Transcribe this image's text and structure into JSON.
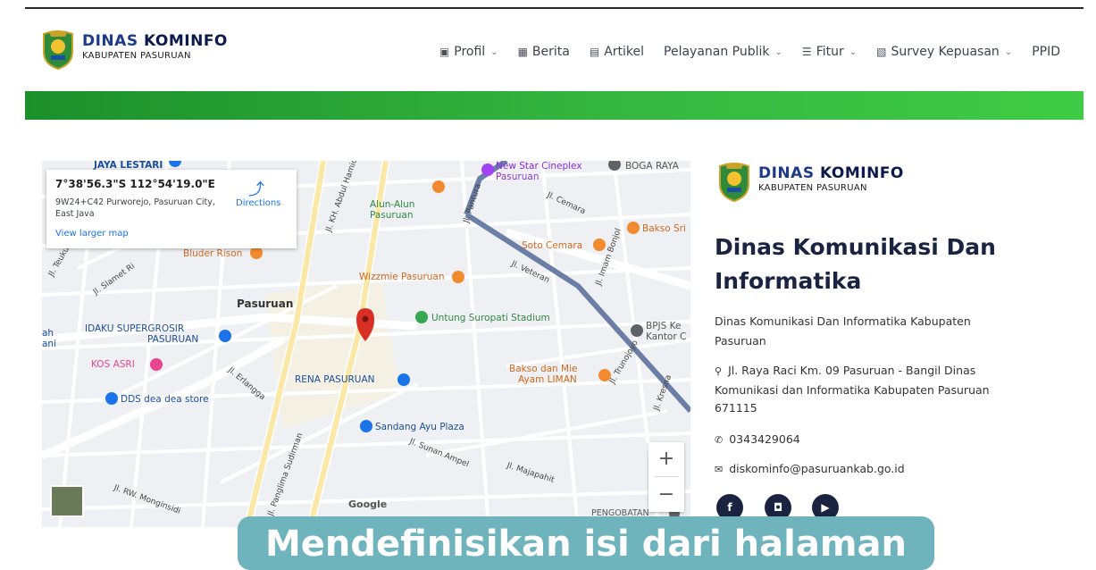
{
  "header": {
    "logo_title_a": "DINAS ",
    "logo_title_b": "KOMINFO",
    "logo_subtitle": "KABUPATEN PASURUAN",
    "nav": [
      {
        "label": "Profil",
        "icon": "image-icon",
        "has_dropdown": true
      },
      {
        "label": "Berita",
        "icon": "newspaper-icon",
        "has_dropdown": false
      },
      {
        "label": "Artikel",
        "icon": "file-icon",
        "has_dropdown": false
      },
      {
        "label": "Pelayanan Publik",
        "icon": "",
        "has_dropdown": true
      },
      {
        "label": "Fitur",
        "icon": "list-icon",
        "has_dropdown": true
      },
      {
        "label": "Survey Kepuasan",
        "icon": "clipboard-icon",
        "has_dropdown": true
      },
      {
        "label": "PPID",
        "icon": "",
        "has_dropdown": false
      }
    ],
    "accent_green": "#2fae3a"
  },
  "map": {
    "coords": "7°38'56.3\"S 112°54'19.0\"E",
    "address": "9W24+C42 Purworejo, Pasuruan City, East Java",
    "view_larger": "View larger map",
    "directions": "Directions",
    "zoom_in": "+",
    "zoom_out": "−",
    "attribution": "Google",
    "labels": {
      "jaya_lestari": "JAYA LESTARI",
      "new_star": "New Star Cineplex",
      "new_star2": "Pasuruan",
      "boga_raya": "BOGA RAYA",
      "alun_alun": "Alun-Alun",
      "alun_alun2": "Pasuruan",
      "bakso_sri": "Bakso Sri",
      "soto_cemara": "Soto Cemara",
      "bluder_rison": "Bluder Rison",
      "wizzmie": "Wizzmie Pasuruan",
      "pasuruan": "Pasuruan",
      "untung_suropati": "Untung Suropati Stadium",
      "bpjs": "BPJS Ke",
      "bpjs2": "Kantor C",
      "idaku": "IDAKU SUPERGROSIR",
      "idaku2": "PASURUAN",
      "kos_asri": "KOS ASRI",
      "rena": "RENA PASURUAN",
      "bakso_mie": "Bakso dan Mie",
      "bakso_mie2": "Ayam LIMAN",
      "dds": "DDS dea dea store",
      "sandang": "Sandang Ayu Plaza",
      "pengobatan": "PENGOBATAN",
      "jl_pantura": "Jl. Pantura",
      "jl_veteran": "Jl. Veteran",
      "jl_sudirman": "Jl. Panglima Sudirman",
      "jl_sunan": "Jl. Sunan Ampel",
      "jl_majapahit": "Jl. Majapahit",
      "jl_erlangga": "Jl. Erlangga",
      "jl_cemara": "Jl. Cemara",
      "jl_imam": "Jl. Imam Bonjol",
      "jl_kh": "Jl. KH. Abdul Hamid",
      "jl_rw": "Jl. RW. Monginsidi",
      "jl_slamet": "Jl. Slamet Ri",
      "jl_teuku": "Jl. Teuku Um",
      "jl_trunojoyo": "Jl. Trunojoyo",
      "jl_kresna": "Jl. Kresna",
      "ah": "ah",
      "ani": "ani"
    }
  },
  "contact": {
    "logo_title_a": "DINAS ",
    "logo_title_b": "KOMINFO",
    "logo_subtitle": "KABUPATEN PASURUAN",
    "title": "Dinas Komunikasi Dan Informatika",
    "description": "Dinas Komunikasi Dan Informatika Kabupaten Pasuruan",
    "address": "Jl. Raya Raci Km. 09 Pasuruan - Bangil Dinas Komunikasi dan Informatika Kabupaten Pasuruan 671115",
    "phone": "0343429064",
    "email": "diskominfo@pasuruankab.go.id",
    "social": [
      {
        "icon": "facebook-icon",
        "glyph": "f"
      },
      {
        "icon": "instagram-icon",
        "glyph": "◘"
      },
      {
        "icon": "youtube-icon",
        "glyph": "▶"
      }
    ]
  },
  "caption": {
    "text": "Mendefinisikan isi dari halaman"
  }
}
